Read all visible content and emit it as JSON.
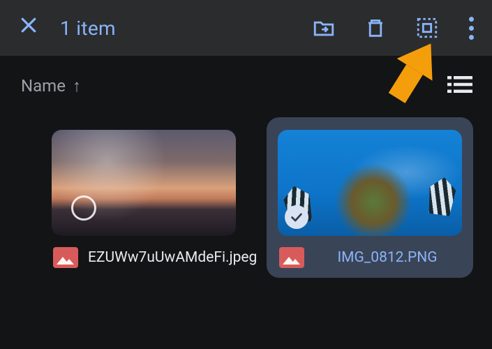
{
  "toolbar": {
    "selection_title": "1 item"
  },
  "sort": {
    "label": "Name",
    "direction": "↑"
  },
  "files": [
    {
      "name": "EZUWw7uUwAMdeFi.jpeg",
      "selected": false,
      "thumb_style": "landscape"
    },
    {
      "name": "IMG_0812.PNG",
      "selected": true,
      "thumb_style": "ocean"
    }
  ]
}
